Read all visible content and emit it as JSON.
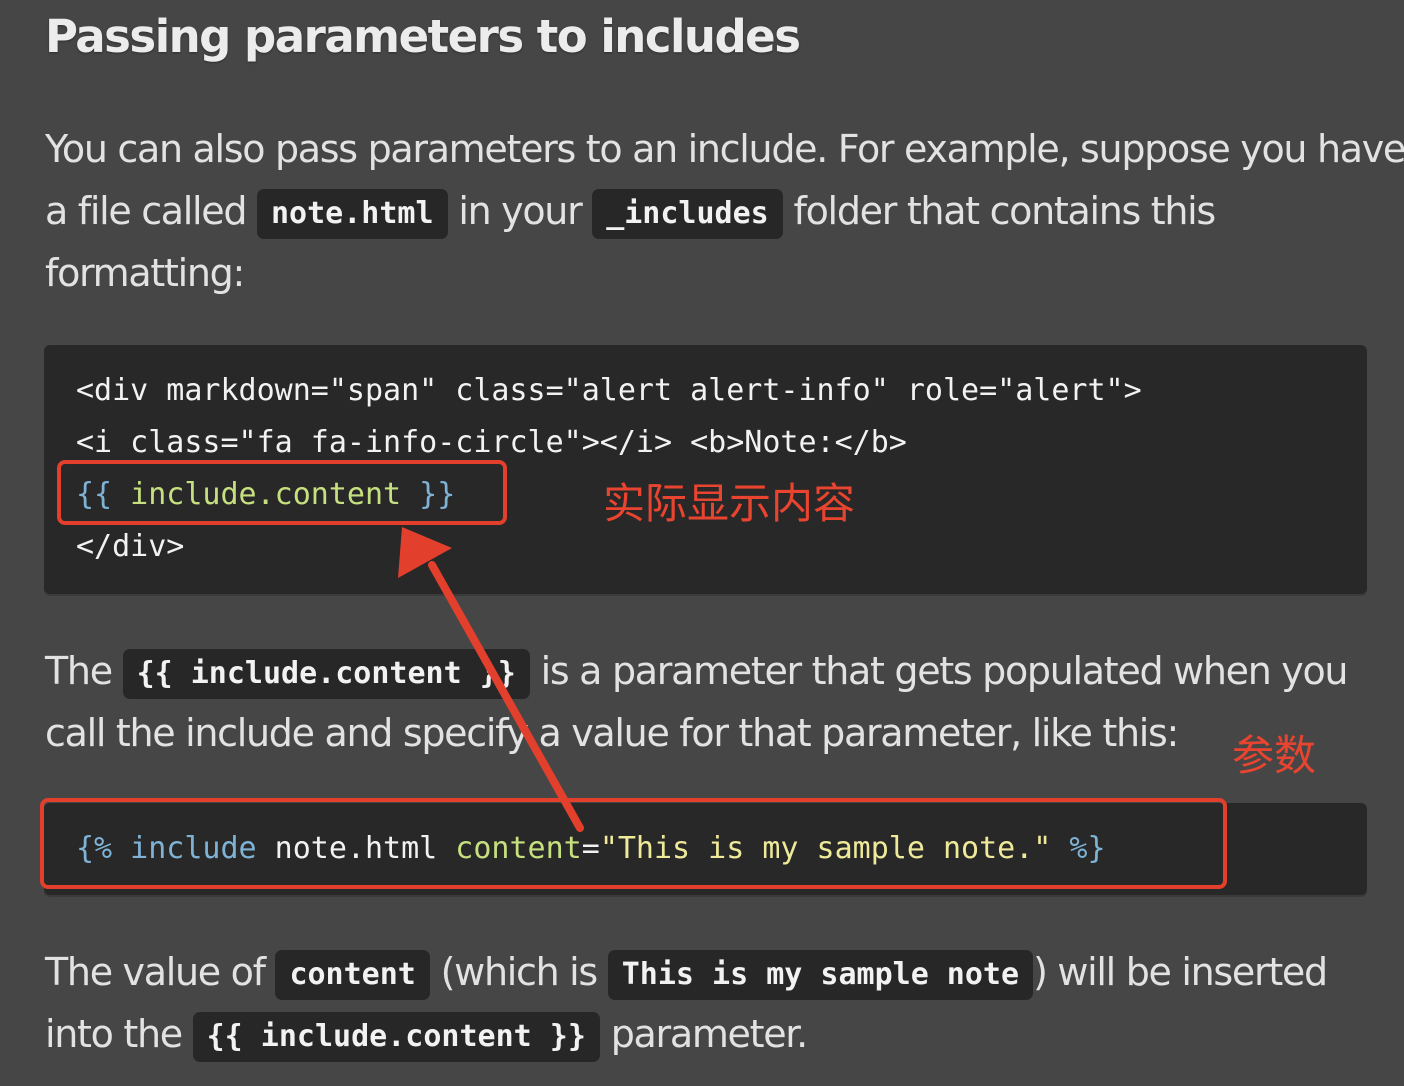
{
  "title": "Passing parameters to includes",
  "p1": {
    "t1": "You can also pass parameters to an include. For example, suppose you have",
    "t2": "a file called ",
    "c1": "note.html",
    "t3": " in your ",
    "c2": "_includes",
    "t4": " folder that contains this",
    "t5": "formatting:"
  },
  "code1": {
    "line1": "<div markdown=\"span\" class=\"alert alert-info\" role=\"alert\">",
    "line2": "<i class=\"fa fa-info-circle\"></i> <b>Note:</b>",
    "line3_open": "{{",
    "line3_mid": " include.content ",
    "line3_close": "}}",
    "line4": "</div>"
  },
  "p2": {
    "t1": "The ",
    "c1": "{{ include.content }}",
    "t2": " is a parameter that gets populated when you",
    "t3": "call the include and specify a value for that parameter, like this:"
  },
  "code2": {
    "open": "{%",
    "kw": " include",
    "file": " note.html",
    "attr": " content",
    "eq": "=",
    "val": "\"This is my sample note.\"",
    "close": " %}"
  },
  "p3": {
    "t1": "The value of ",
    "c1": "content",
    "t2": " (which is ",
    "c2": "This is my sample note",
    "t3": ") will be inserted",
    "t4": "into the ",
    "c3": "{{ include.content }}",
    "t5": " parameter."
  },
  "annotations": {
    "actual_content": "实际显示内容",
    "parameter": "参数"
  },
  "colors": {
    "background": "#464646",
    "code_background": "#282828",
    "annotation_red": "#e2402c"
  }
}
